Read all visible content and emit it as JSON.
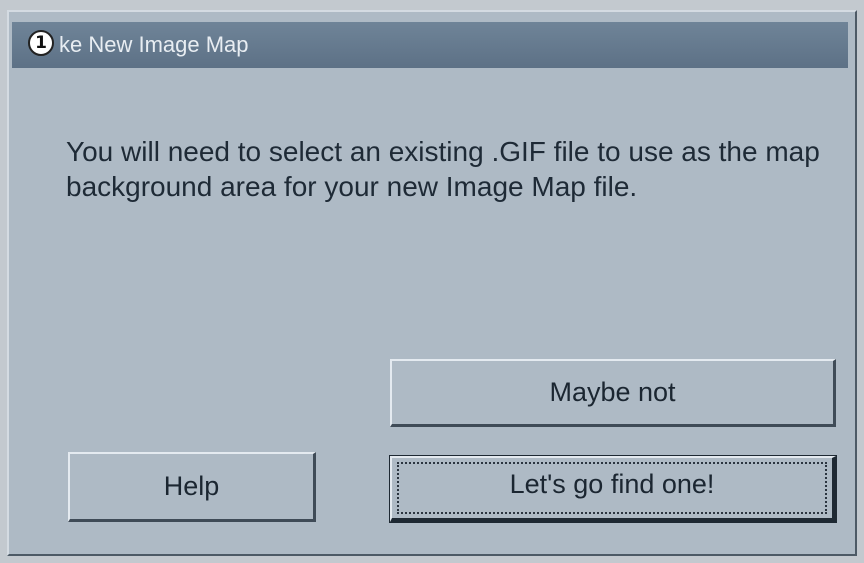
{
  "dialog": {
    "title_badge": "1",
    "title": "ke New Image Map",
    "message": "You will need to select an existing .GIF file to use as the map background area for your new Image Map file.",
    "buttons": {
      "maybe_not": "Maybe not",
      "help": "Help",
      "find": "Let's go find one!"
    }
  }
}
